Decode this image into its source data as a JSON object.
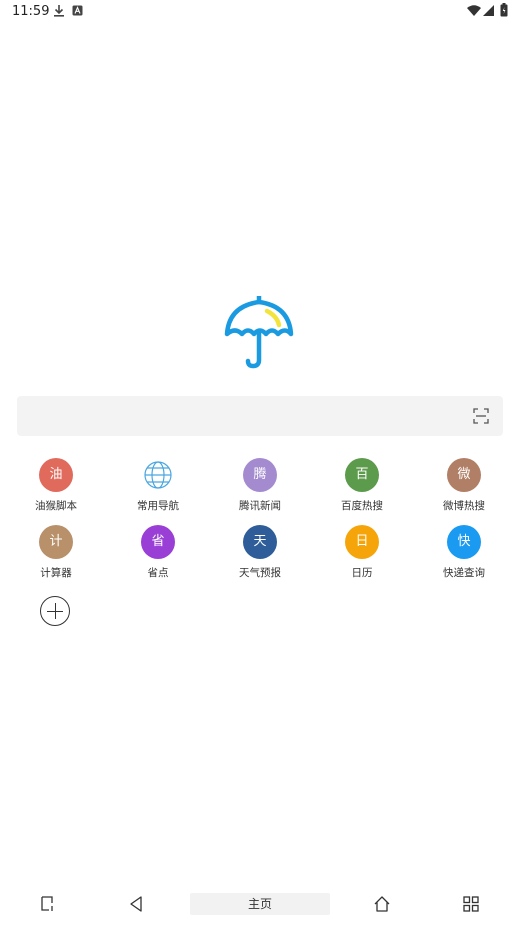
{
  "status_bar": {
    "time": "11:59"
  },
  "search": {
    "placeholder": ""
  },
  "shortcuts": [
    {
      "id": "youhou",
      "glyph": "油",
      "label": "油猴脚本",
      "color": "#e06a5c"
    },
    {
      "id": "nav",
      "glyph": "",
      "label": "常用导航",
      "color": "#4aa6e0",
      "icon": "globe-icon"
    },
    {
      "id": "tencent",
      "glyph": "腾",
      "label": "腾讯新闻",
      "color": "#a48bd0"
    },
    {
      "id": "baidu",
      "glyph": "百",
      "label": "百度热搜",
      "color": "#5c9a4c"
    },
    {
      "id": "weibo",
      "glyph": "微",
      "label": "微博热搜",
      "color": "#b07f66"
    },
    {
      "id": "calc",
      "glyph": "计",
      "label": "计算器",
      "color": "#b8906a"
    },
    {
      "id": "shengdian",
      "glyph": "省",
      "label": "省点",
      "color": "#9a3fd6"
    },
    {
      "id": "weather",
      "glyph": "天",
      "label": "天气预报",
      "color": "#2e5d9a"
    },
    {
      "id": "calendar",
      "glyph": "日",
      "label": "日历",
      "color": "#f5a50a"
    },
    {
      "id": "express",
      "glyph": "快",
      "label": "快递查询",
      "color": "#1a9af0"
    }
  ],
  "bottom_bar": {
    "home_label": "主页"
  },
  "colors": {
    "accent": "#1a9ae0",
    "logo_highlight": "#f2e43c"
  }
}
